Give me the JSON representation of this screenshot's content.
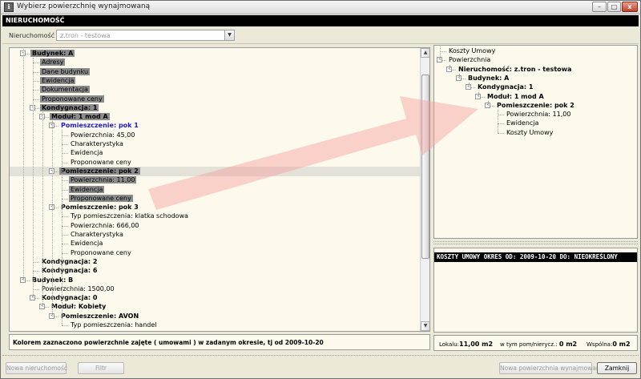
{
  "window": {
    "title": "Wybierz powierzchnię wynajmowaną",
    "icon": "app-icon"
  },
  "titlebar_buttons": {
    "minimize": "–",
    "maximize": "□",
    "close": "x"
  },
  "section_header": "NIERUCHOMOŚĆ",
  "filter": {
    "label": "Nieruchomość",
    "value": "z.tron - testowa",
    "dropdown_glyph": "▼"
  },
  "left_tree": [
    {
      "text": "Budynek: A",
      "level": 0,
      "style": "hl-b",
      "exp": "-"
    },
    {
      "text": "Adresy",
      "level": 1,
      "style": "hl"
    },
    {
      "text": "Dane budynku",
      "level": 1,
      "style": "hl"
    },
    {
      "text": "Ewidencja",
      "level": 1,
      "style": "hl"
    },
    {
      "text": "Dokumentacja",
      "level": 1,
      "style": "hl"
    },
    {
      "text": "Proponowane ceny",
      "level": 1,
      "style": "hl"
    },
    {
      "text": "Kondygnacja: 1",
      "level": 1,
      "style": "hl-b",
      "exp": "-"
    },
    {
      "text": "Moduł: 1 mod A",
      "level": 2,
      "style": "hl-b",
      "exp": "-"
    },
    {
      "text": "Pomieszczenie: pok 1",
      "level": 3,
      "style": "blue",
      "exp": "-"
    },
    {
      "text": "Powierzchnia: 45,00",
      "level": 4,
      "style": ""
    },
    {
      "text": "Charakterystyka",
      "level": 4,
      "style": ""
    },
    {
      "text": "Ewidencja",
      "level": 4,
      "style": ""
    },
    {
      "text": "Proponowane ceny",
      "level": 4,
      "style": ""
    },
    {
      "text": "Pomieszczenie: pok 2",
      "level": 3,
      "style": "hl-b",
      "exp": "-",
      "selected": true
    },
    {
      "text": "Powierzchnia: 11,00",
      "level": 4,
      "style": "hl"
    },
    {
      "text": "Ewidencja",
      "level": 4,
      "style": "hl"
    },
    {
      "text": "Proponowane ceny",
      "level": 4,
      "style": "hl"
    },
    {
      "text": "Pomieszczenie: pok 3",
      "level": 3,
      "style": "bold",
      "exp": "-"
    },
    {
      "text": "Typ pomieszczenia: klatka schodowa",
      "level": 4,
      "style": ""
    },
    {
      "text": "Powierzchnia: 666,00",
      "level": 4,
      "style": ""
    },
    {
      "text": "Charakterystyka",
      "level": 4,
      "style": ""
    },
    {
      "text": "Ewidencja",
      "level": 4,
      "style": ""
    },
    {
      "text": "Proponowane ceny",
      "level": 4,
      "style": ""
    },
    {
      "text": "Kondygnacja: 2",
      "level": 1,
      "style": "bold"
    },
    {
      "text": "Kondygnacja: 6",
      "level": 1,
      "style": "bold"
    },
    {
      "text": "Budynek: B",
      "level": 0,
      "style": "bold",
      "exp": "-"
    },
    {
      "text": "Powierzchnia: 1500,00",
      "level": 1,
      "style": ""
    },
    {
      "text": "Kondygnacja: 0",
      "level": 1,
      "style": "bold",
      "exp": "-"
    },
    {
      "text": "Moduł: Kobiety",
      "level": 2,
      "style": "bold",
      "exp": "-"
    },
    {
      "text": "Pomieszczenie: AVON",
      "level": 3,
      "style": "bold",
      "exp": "-"
    },
    {
      "text": "Typ pomieszczenia: handel",
      "level": 4,
      "style": ""
    }
  ],
  "status_text": "Kolorem zaznaczono powierzchnie zajęte ( umowami ) w zadanym okresie, tj od 2009-10-20",
  "right_tree": [
    {
      "text": "Koszty Umowy",
      "level": 0,
      "style": ""
    },
    {
      "text": "Powierzchnia",
      "level": 0,
      "style": "",
      "exp": "-"
    },
    {
      "text": "Nieruchomość: z.tron - testowa",
      "level": 1,
      "style": "bold",
      "exp": "-"
    },
    {
      "text": "Budynek: A",
      "level": 2,
      "style": "bold",
      "exp": "-"
    },
    {
      "text": "Kondygnacja: 1",
      "level": 3,
      "style": "bold",
      "exp": "-"
    },
    {
      "text": "Moduł: 1 mod A",
      "level": 4,
      "style": "bold",
      "exp": "-"
    },
    {
      "text": "Pomieszczenie: pok 2",
      "level": 5,
      "style": "bold",
      "exp": "-"
    },
    {
      "text": "Powierzchnia: 11,00",
      "level": 6,
      "style": ""
    },
    {
      "text": "Ewidencja",
      "level": 6,
      "style": ""
    },
    {
      "text": "Koszty Umowy",
      "level": 6,
      "style": ""
    }
  ],
  "costs_header": "KOSZTY UMOWY OKRES OD: 2009-10-20 DO: NIEOKREŚLONY",
  "summary": {
    "lokal_label": "Lokalu:",
    "lokal_value": "11,00 m2",
    "pom_label": "w tym pom/nierycz.:",
    "pom_value": "0 m2",
    "wspolna_label": "Wspólna:",
    "wspolna_value": "0 m2"
  },
  "buttons": {
    "new_property": "Nowa nieruchomość",
    "filter": "Filtr",
    "new_rented_area": "Nowa powierzchnia wynajmowana",
    "close": "Zamknij"
  },
  "colors": {
    "highlight": "#8c8c8c",
    "tree_bg": "#fdf9ec",
    "blue_text": "#1a1ad0",
    "arrow": "#f4a0a0"
  }
}
